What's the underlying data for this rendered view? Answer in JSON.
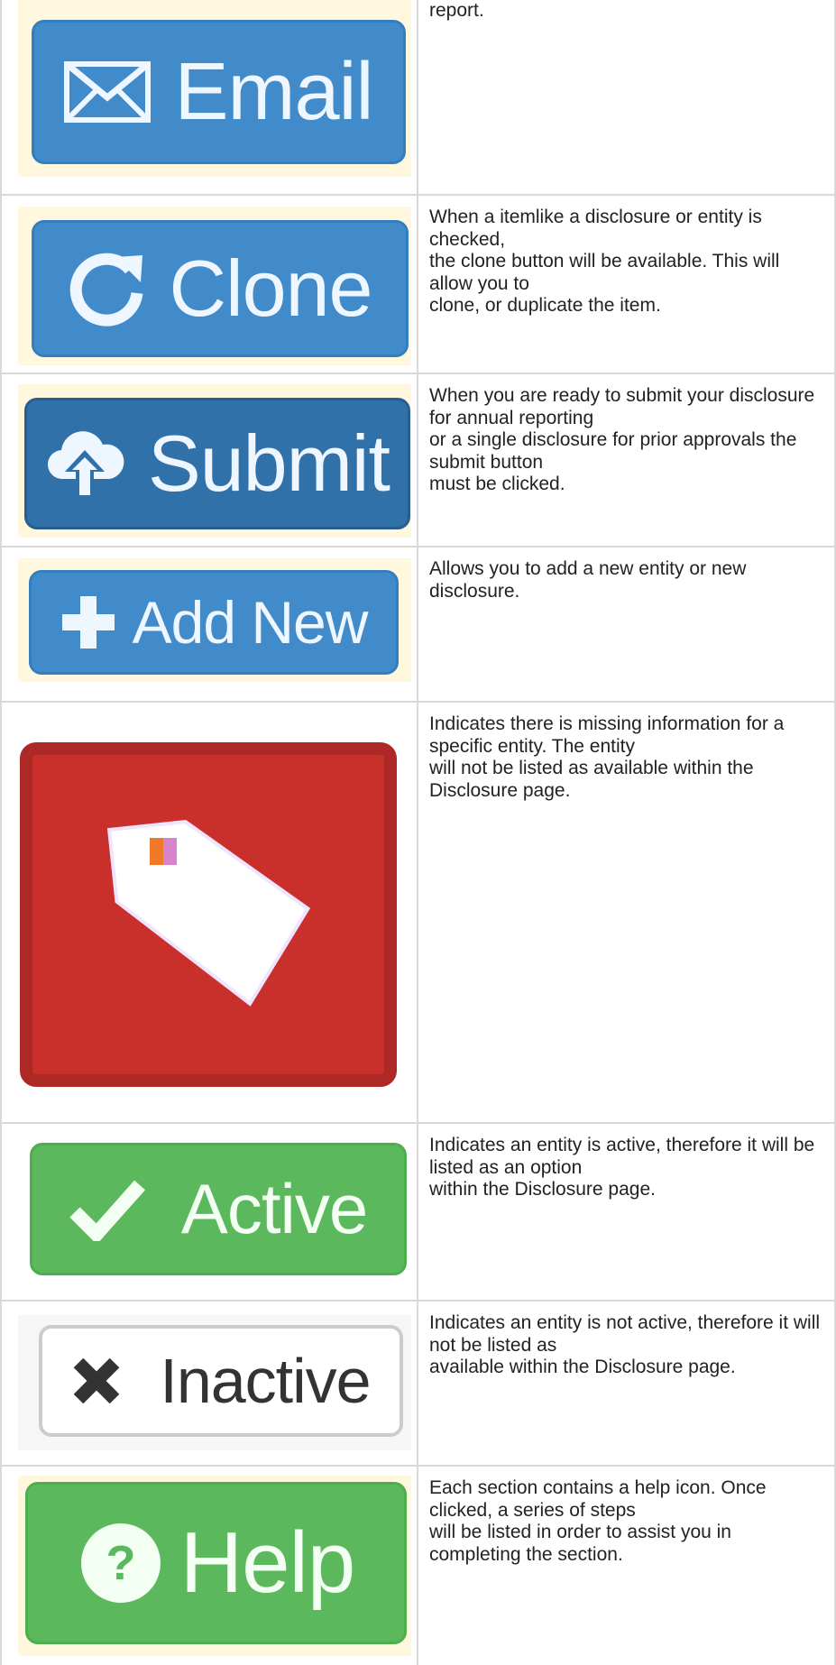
{
  "rows": [
    {
      "button_label": "Email",
      "icon": "envelope-icon",
      "description": "report."
    },
    {
      "button_label": "Clone",
      "icon": "refresh-icon",
      "description": "When a itemlike a disclosure or entity is checked,\nthe clone button will be available. This will allow you to\nclone, or duplicate the item."
    },
    {
      "button_label": "Submit",
      "icon": "cloud-upload-icon",
      "description": "When you are ready to submit your disclosure for annual reporting\nor a single disclosure for prior approvals the submit button\nmust be clicked."
    },
    {
      "button_label": "Add New",
      "icon": "plus-icon",
      "description": "Allows you to add a new entity or new disclosure."
    },
    {
      "button_label": "",
      "icon": "tag-icon",
      "description": "Indicates there is missing information for a specific entity. The entity\nwill not be listed as available within the Disclosure page."
    },
    {
      "button_label": "Active",
      "icon": "checkmark-icon",
      "description": "Indicates an entity is active, therefore it will be listed as an option\nwithin the Disclosure page."
    },
    {
      "button_label": "Inactive",
      "icon": "x-icon",
      "description": "Indicates an entity is not active, therefore it will not be listed as\navailable within the Disclosure page."
    },
    {
      "button_label": "Help",
      "icon": "question-circle-icon",
      "description": "Each section contains a help icon. Once clicked, a series of steps\nwill be listed in order to assist you in completing the section."
    }
  ],
  "colors": {
    "primary_blue": "#428bca",
    "dark_blue": "#3071a9",
    "danger_red": "#c9302c",
    "success_green": "#5cb85c",
    "frame_cream": "#fff8df"
  }
}
